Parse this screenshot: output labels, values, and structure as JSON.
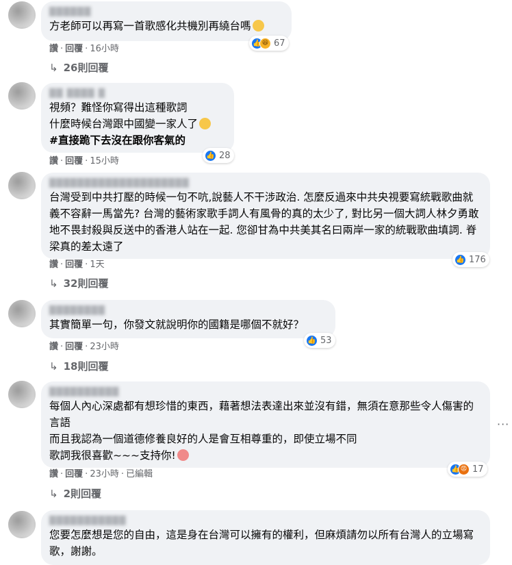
{
  "comments": [
    {
      "name": "██████",
      "text": "方老師可以再寫一首歌感化共機別再繞台嗎",
      "reactions": {
        "icons": [
          "like-icon",
          "haha-icon"
        ],
        "count": "67"
      },
      "actions": {
        "like": "讚",
        "reply": "回覆",
        "time": "16小時"
      },
      "replies": "26則回覆"
    },
    {
      "name": "██ ████ █",
      "line1": "視頻？難怪你寫得出這種歌詞",
      "line2": "什麼時候台灣跟中國變一家人了",
      "line3": "#直接跪下去沒在跟你客氣的",
      "reactions": {
        "icons": [
          "like-icon"
        ],
        "count": "28"
      },
      "actions": {
        "like": "讚",
        "reply": "回覆",
        "time": "15小時"
      }
    },
    {
      "name": "████████████████████",
      "text": "台灣受到中共打壓的時候一句不吭,說藝人不干涉政治. 怎麼反過來中共央視要寫統戰歌曲就義不容辭一馬當先? 台灣的藝術家歌手詞人有風骨的真的太少了, 對比另一個大詞人林夕勇敢地不畏封殺與反送中的香港人站在一起. 您卻甘為中共美其名曰兩岸一家的統戰歌曲填詞. 脊梁真的差太遠了",
      "reactions": {
        "icons": [
          "like-icon"
        ],
        "count": "176"
      },
      "actions": {
        "like": "讚",
        "reply": "回覆",
        "time": "1天"
      },
      "replies": "32則回覆"
    },
    {
      "name": "████████",
      "text": "其實簡單一句，你發文就說明你的國籍是哪個不就好？",
      "reactions": {
        "icons": [
          "like-icon"
        ],
        "count": "53"
      },
      "actions": {
        "like": "讚",
        "reply": "回覆",
        "time": "23小時"
      },
      "replies": "18則回覆"
    },
    {
      "name": "██████████",
      "line1": "每個人內心深處都有想珍惜的東西，藉著想法表達出來並沒有錯，無須在意那些令人傷害的言語",
      "line2": "而且我認為一個道德修養良好的人是會互相尊重的，即使立場不同",
      "line3": "歌詞我很喜歡~~~支持你!",
      "reactions": {
        "icons": [
          "like-icon",
          "angry-icon"
        ],
        "count": "17"
      },
      "actions": {
        "like": "讚",
        "reply": "回覆",
        "time": "23小時",
        "edited": "已編輯"
      },
      "replies": "2則回覆",
      "more": "···"
    },
    {
      "name": "███████████",
      "text": "您要怎麼想是您的自由，這是身在台灣可以擁有的權利，但麻煩請勿以所有台灣人的立場寫歌，謝謝。"
    }
  ],
  "colors": {
    "bubble": "#f0f2f5",
    "like": "#1877f2",
    "meta": "#65676b"
  }
}
